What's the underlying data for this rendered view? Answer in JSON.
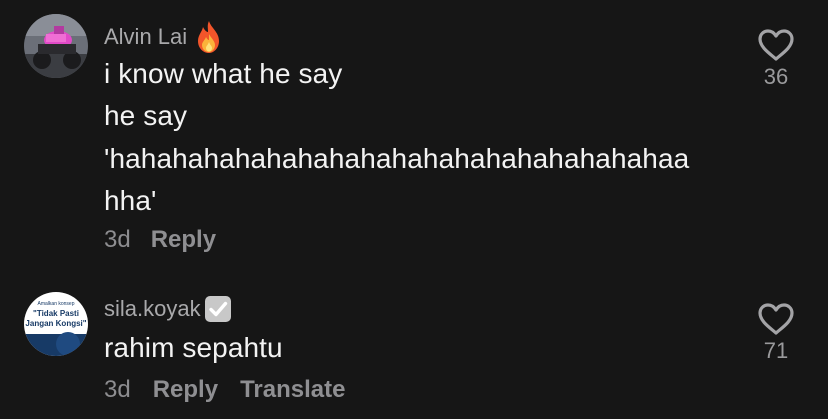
{
  "comments": [
    {
      "username": "Alvin Lai",
      "username_emoji": "fire-icon",
      "lines": [
        "i know what he say",
        "he say",
        "'hahahahahahahahahahahahahahahahahahaa",
        "hha'"
      ],
      "age": "3d",
      "reply_label": "Reply",
      "likes": "36"
    },
    {
      "username": "sila.koyak",
      "username_badge": "verified-check-icon",
      "avatar_text": {
        "small": "Amalkan konsep",
        "line1": "\"Tidak Pasti",
        "line2": "Jangan Kongsi\""
      },
      "lines": [
        "rahim sepahtu"
      ],
      "age": "3d",
      "reply_label": "Reply",
      "translate_label": "Translate",
      "likes": "71"
    }
  ],
  "colors": {
    "background": "#161616",
    "username": "#a9a9ab",
    "comment_text": "#f3f3f3",
    "meta": "#8d8d90"
  }
}
